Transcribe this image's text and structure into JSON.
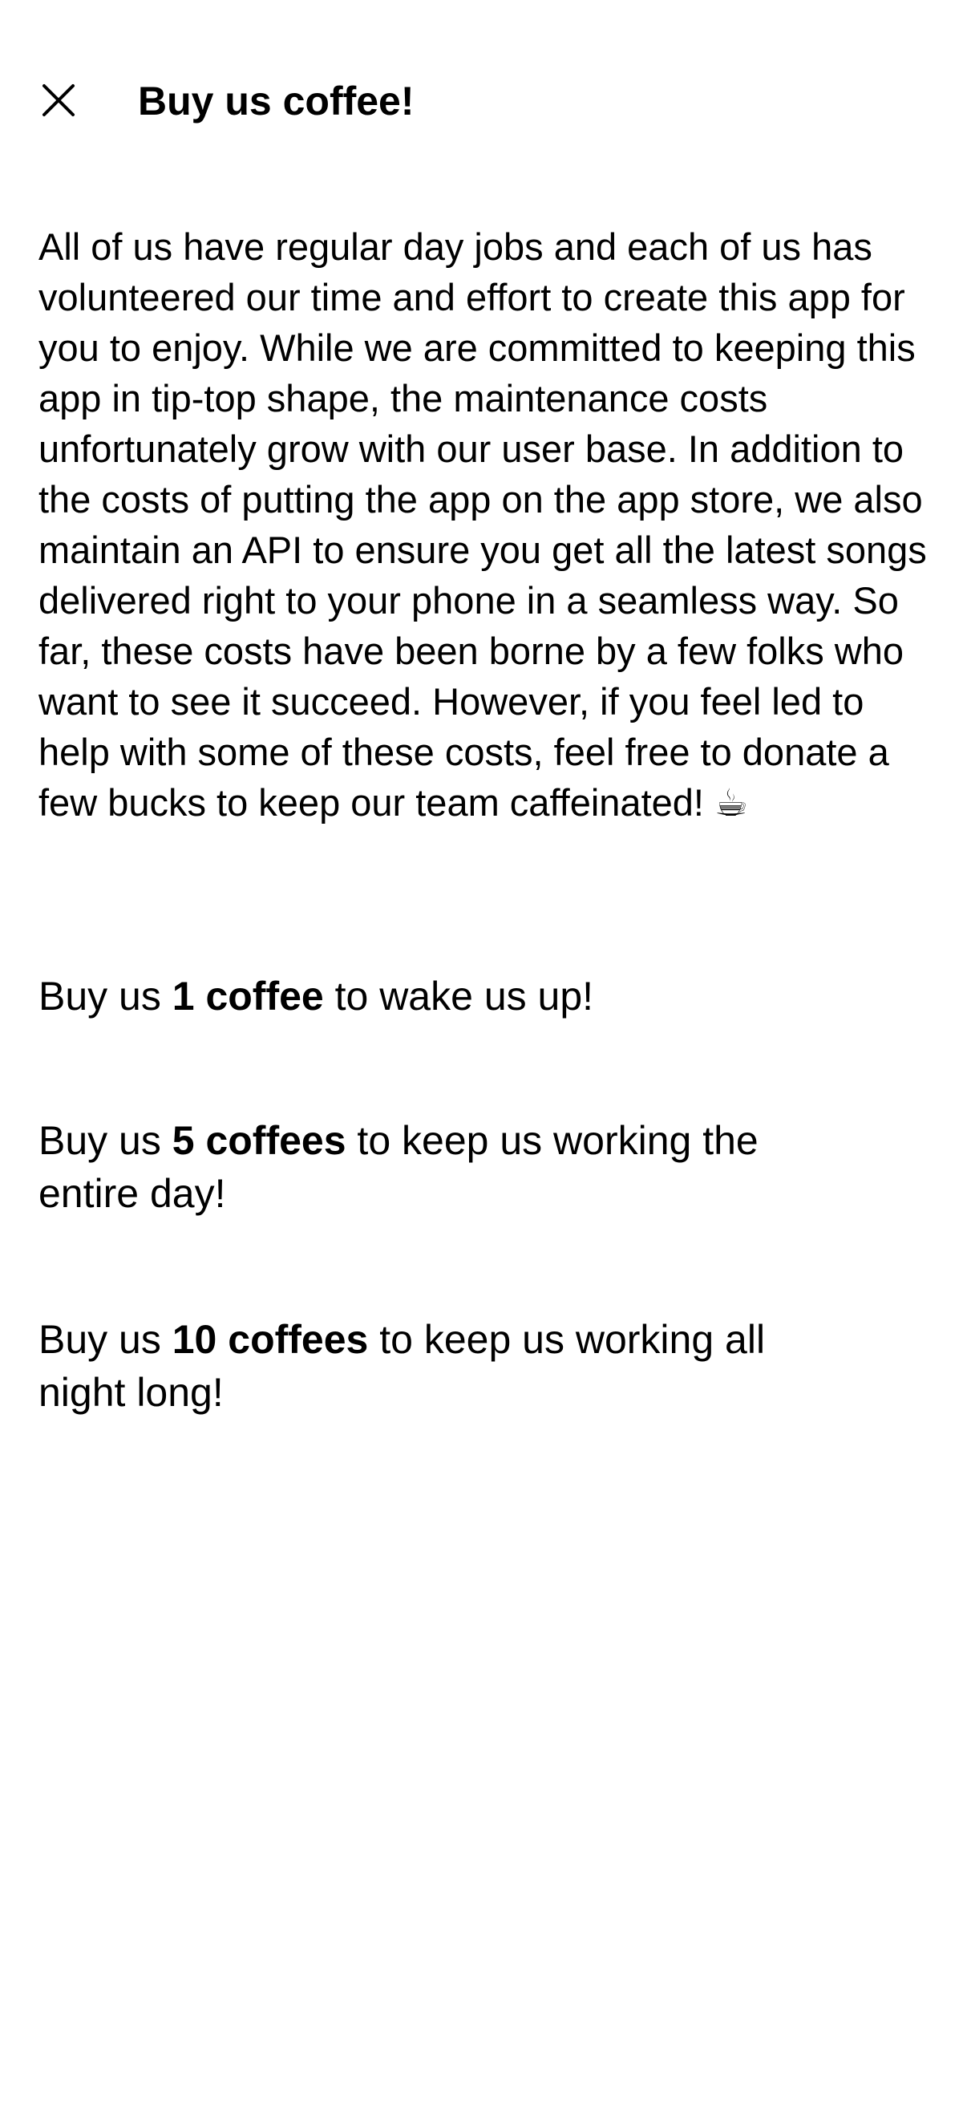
{
  "header": {
    "close_icon": "close-icon",
    "title": "Buy us coffee!"
  },
  "intro": {
    "text": "All of us have regular day jobs and each of us has volunteered our time and effort to create this app for you to enjoy. While we are committed to keeping this app in tip-top shape, the maintenance costs unfortunately grow with our user base. In addition to the costs of putting the app on the app store, we also maintain an API to ensure you get all the latest songs delivered right to your phone in a seamless way. So far, these costs have been borne by a few folks who want to see it succeed. However, if you feel led to help with some of these costs, feel free to donate a few bucks to keep our team caffeinated! ☕"
  },
  "offers": [
    {
      "prefix": "Buy us ",
      "amount": "1 coffee",
      "suffix": " to wake us up!"
    },
    {
      "prefix": "Buy us ",
      "amount": "5 coffees",
      "suffix": " to keep us working the entire day!"
    },
    {
      "prefix": "Buy us ",
      "amount": "10 coffees",
      "suffix": " to keep us working all night long!"
    }
  ]
}
